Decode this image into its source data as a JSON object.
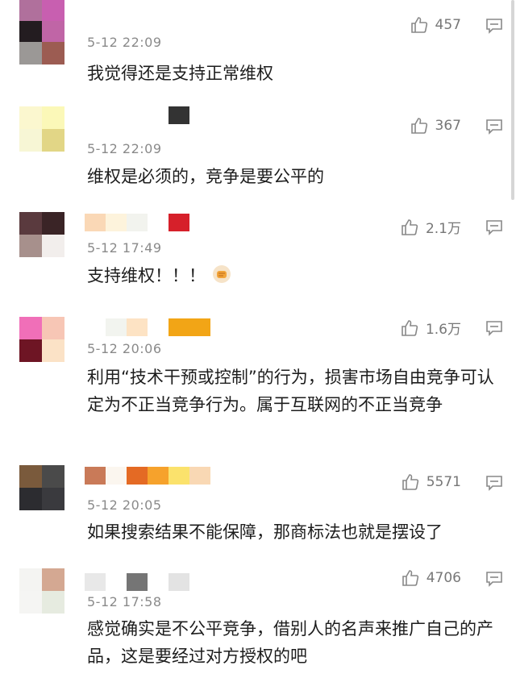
{
  "comments": [
    {
      "timestamp": "5-12 22:09",
      "text": "我觉得还是支持正常维权",
      "likes": "457",
      "avatar_colors": [
        "#b0709c",
        "#c85fb0",
        "#231c20",
        "#c065a6",
        "#9b9896",
        "#9c5c52"
      ],
      "name_colors": []
    },
    {
      "timestamp": "5-12 22:09",
      "text": "维权是必须的，竞争是要公平的",
      "likes": "367",
      "avatar_colors": [
        "#fbf7cf",
        "#fbf8b8",
        "#f7f6d5",
        "#e2d686"
      ],
      "name_colors": [
        "#ffffff",
        "#ffffff",
        "#ffffff",
        "#ffffff",
        "#333333"
      ]
    },
    {
      "timestamp": "5-12 17:49",
      "text": "支持维权！！！",
      "likes": "2.1万",
      "avatar_colors": [
        "#5a3a3e",
        "#3a2426",
        "#a7908c",
        "#f2eeec"
      ],
      "name_colors": [
        "#fad8b6",
        "#fdf3dc",
        "#f2f3ee",
        "#ffffff",
        "#d6202a"
      ]
    },
    {
      "timestamp": "5-12 20:06",
      "text": "利用“技术干预或控制”的行为，损害市场自由竞争可认定为不正当竞争行为。属于互联网的不正当竞争",
      "likes": "1.6万",
      "avatar_colors": [
        "#f06fb8",
        "#f7c6b5",
        "#6e1524",
        "#fbe2c6"
      ],
      "name_colors": [
        "#ffffff",
        "#f2f4ef",
        "#fde3c4",
        "#ffffff",
        "#f2a516",
        "#f2a516"
      ]
    },
    {
      "timestamp": "5-12 20:05",
      "text": "如果搜索结果不能保障，那商标法也就是摆设了",
      "likes": "5571",
      "avatar_colors": [
        "#7a5a3c",
        "#4a4a4a",
        "#2c2c30",
        "#3a3a3e"
      ],
      "name_colors": [
        "#c97a58",
        "#fbf6ef",
        "#e46a24",
        "#f6a22c",
        "#fbe26c",
        "#f9d8b4"
      ]
    },
    {
      "timestamp": "5-12 17:58",
      "text": "感觉确实是不公平竞争，借别人的名声来推广自己的产品，这是要经过对方授权的吧",
      "likes": "4706",
      "avatar_colors": [
        "#f4f4f2",
        "#d4a892",
        "#f5f5f3",
        "#e6ebe0"
      ],
      "name_colors": [
        "#e8e8e8",
        "#ffffff",
        "#757575",
        "#ffffff",
        "#e3e3e3"
      ]
    }
  ]
}
